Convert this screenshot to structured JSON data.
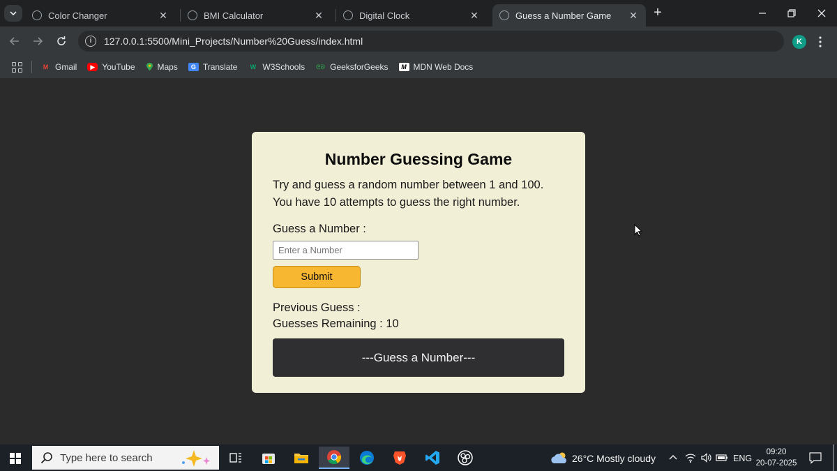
{
  "browser": {
    "tabs": [
      {
        "title": "Color Changer",
        "active": false
      },
      {
        "title": "BMI Calculator",
        "active": false
      },
      {
        "title": "Digital Clock",
        "active": false
      },
      {
        "title": "Guess a Number Game",
        "active": true
      }
    ],
    "url": "127.0.0.1:5500/Mini_Projects/Number%20Guess/index.html",
    "profile_initial": "K",
    "bookmarks": [
      {
        "label": "Gmail",
        "icon": "gmail-icon"
      },
      {
        "label": "YouTube",
        "icon": "youtube-icon"
      },
      {
        "label": "Maps",
        "icon": "maps-icon"
      },
      {
        "label": "Translate",
        "icon": "translate-icon"
      },
      {
        "label": "W3Schools",
        "icon": "w3schools-icon"
      },
      {
        "label": "GeeksforGeeks",
        "icon": "geeksforgeeks-icon"
      },
      {
        "label": "MDN Web Docs",
        "icon": "mdn-icon"
      }
    ]
  },
  "game": {
    "title": "Number Guessing Game",
    "intro_line1": "Try and guess a random number between 1 and 100.",
    "intro_line2": "You have 10 attempts to guess the right number.",
    "guess_label": "Guess a Number :",
    "input_placeholder": "Enter a Number",
    "input_value": "",
    "submit_label": "Submit",
    "previous_guess_label": "Previous Guess :",
    "guesses_remaining_label": "Guesses Remaining :",
    "guesses_remaining": "10",
    "message": "---Guess a Number---"
  },
  "taskbar": {
    "search_placeholder": "Type here to search",
    "weather": "26°C  Mostly cloudy",
    "language": "ENG",
    "time": "09:20",
    "date": "20-07-2025"
  },
  "colors": {
    "card_bg": "#f2efd7",
    "page_bg": "#2b2b2b",
    "submit_bg": "#f7b731",
    "message_bg": "#2f2f31"
  }
}
